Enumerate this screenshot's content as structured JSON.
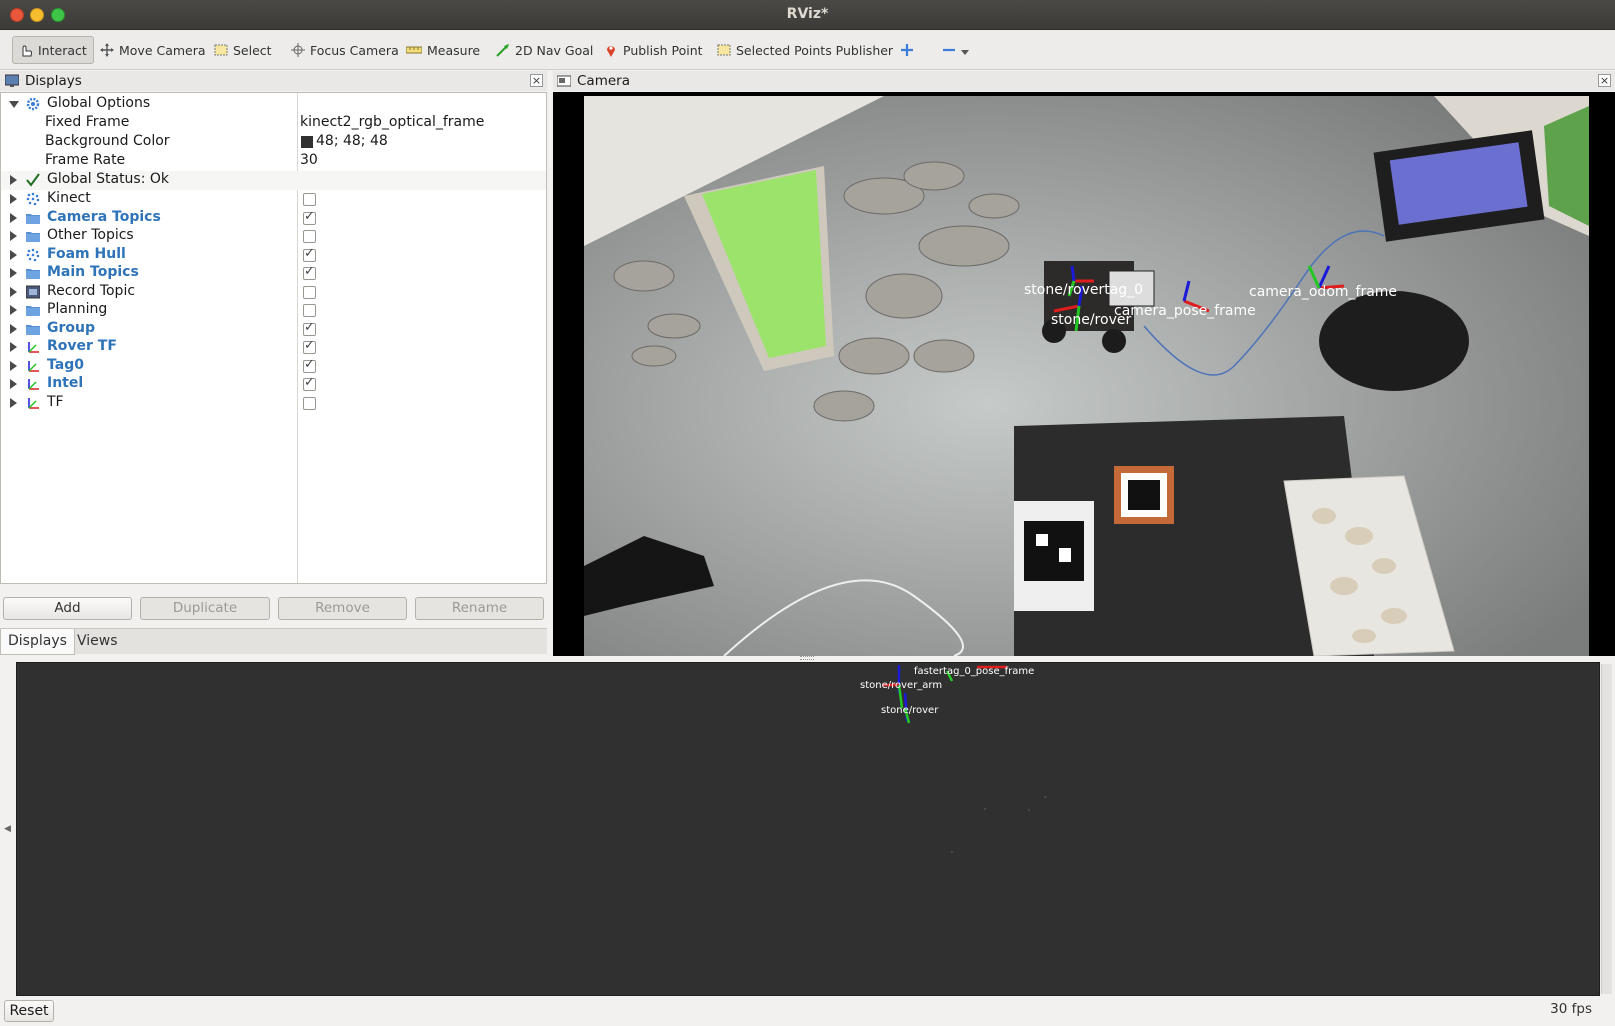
{
  "window": {
    "title": "RViz*"
  },
  "toolbar": {
    "interact": "Interact",
    "move_camera": "Move Camera",
    "select": "Select",
    "focus_camera": "Focus Camera",
    "measure": "Measure",
    "nav_goal": "2D Nav Goal",
    "publish_point": "Publish Point",
    "selected_points": "Selected Points Publisher"
  },
  "displays": {
    "title": "Displays",
    "global_options": "Global Options",
    "fixed_frame_label": "Fixed Frame",
    "fixed_frame_value": "kinect2_rgb_optical_frame",
    "bg_color_label": "Background Color",
    "bg_color_value": "48; 48; 48",
    "frame_rate_label": "Frame Rate",
    "frame_rate_value": "30",
    "global_status": "Global Status: Ok",
    "items": [
      {
        "label": "Kinect",
        "checked": false
      },
      {
        "label": "Camera Topics",
        "checked": true
      },
      {
        "label": "Other Topics",
        "checked": false
      },
      {
        "label": "Foam Hull",
        "checked": true
      },
      {
        "label": "Main Topics",
        "checked": true
      },
      {
        "label": "Record Topic",
        "checked": false
      },
      {
        "label": "Planning",
        "checked": false
      },
      {
        "label": "Group",
        "checked": true
      },
      {
        "label": "Rover TF",
        "checked": true
      },
      {
        "label": "Tag0",
        "checked": true
      },
      {
        "label": "Intel",
        "checked": true
      },
      {
        "label": "TF",
        "checked": false
      }
    ],
    "buttons": {
      "add": "Add",
      "duplicate": "Duplicate",
      "remove": "Remove",
      "rename": "Rename"
    },
    "tabs": {
      "displays": "Displays",
      "views": "Views"
    }
  },
  "camera": {
    "title": "Camera",
    "labels": {
      "stone_rover_arm": "stone/rovertag_0",
      "stone_rover": "stone/rover",
      "camera_pose_frame": "camera_pose_frame",
      "camera_odom_frame": "camera_odom_frame"
    }
  },
  "view3d": {
    "labels": {
      "top_cluster": "fastertag_0_pose_frame",
      "rover_arm": "stone/rover_arm",
      "rover": "stone/rover"
    }
  },
  "footer": {
    "reset": "Reset",
    "fps": "30 fps"
  },
  "colors": {
    "accent": "#2f74b8",
    "background_3d": "#303030",
    "titlebar": "#3c3b37"
  }
}
